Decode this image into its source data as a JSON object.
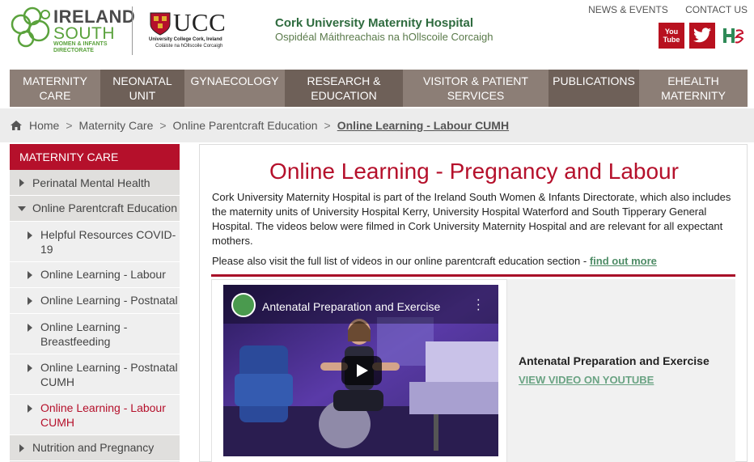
{
  "brand": {
    "is_logo_line1": "IRELAND",
    "is_logo_line2": "SOUTH",
    "is_logo_line3": "WOMEN & INFANTS DIRECTORATE",
    "ucc_logo": "UCC",
    "ucc_sub1": "University College Cork, Ireland",
    "ucc_sub2": "Coláiste na hOllscoile Corcaigh",
    "hospital_name": "Cork University Maternity Hospital",
    "hospital_irish": "Ospidéal Máithreachais na hOllscoile Corcaigh",
    "accent": "#b5102b",
    "nav_color": "#8c7e76",
    "nav_active_color": "#6e6058"
  },
  "toplinks": [
    "NEWS & EVENTS",
    "CONTACT US"
  ],
  "social": {
    "youtube_label_1": "You",
    "youtube_label_2": "Tube",
    "icons": [
      "youtube-icon",
      "twitter-icon",
      "hse-icon"
    ]
  },
  "nav": [
    {
      "label_1": "MATERNITY",
      "label_2": "CARE",
      "dark": false
    },
    {
      "label_1": "NEONATAL",
      "label_2": "UNIT",
      "dark": true
    },
    {
      "label_1": "GYNAECOLOGY",
      "label_2": "",
      "dark": false
    },
    {
      "label_1": "RESEARCH &",
      "label_2": "EDUCATION",
      "dark": true
    },
    {
      "label_1": "VISITOR & PATIENT",
      "label_2": "SERVICES",
      "dark": false
    },
    {
      "label_1": "PUBLICATIONS",
      "label_2": "",
      "dark": true
    },
    {
      "label_1": "EHEALTH",
      "label_2": "MATERNITY",
      "dark": false
    }
  ],
  "breadcrumb": {
    "home": "Home",
    "items": [
      "Maternity Care",
      "Online Parentcraft Education"
    ],
    "current": "Online Learning - Labour CUMH",
    "separator": ">"
  },
  "sidebar": {
    "heading": "MATERNITY CARE",
    "items": [
      {
        "label": "Perinatal Mental Health"
      },
      {
        "label": "Online Parentcraft Education"
      },
      {
        "label_1": "Helpful Resources COVID-",
        "label_2": "19"
      },
      {
        "label": "Online Learning - Labour"
      },
      {
        "label": "Online Learning - Postnatal"
      },
      {
        "label_1": "Online Learning -",
        "label_2": "Breastfeeding"
      },
      {
        "label_1": "Online Learning - Postnatal",
        "label_2": "CUMH"
      },
      {
        "label_1": "Online Learning - Labour",
        "label_2": "CUMH"
      },
      {
        "label": "Nutrition and Pregnancy"
      }
    ]
  },
  "main": {
    "title": "Online Learning - Pregnancy and Labour",
    "intro": "Cork University Maternity Hospital is part of the Ireland South Women & Infants Directorate, which also includes the maternity units of University Hospital Kerry, University Hospital Waterford and South Tipperary General Hospital.  The videos below were filmed in Cork University Maternity Hospital and are relevant for all expectant mothers.",
    "also_text": "Please also visit the full list of videos in our online parentcraft education section - ",
    "also_link": "find out more",
    "video": {
      "player_title": "Antenatal Preparation and Exercise",
      "title": "Antenatal Preparation and Exercise",
      "link": "VIEW VIDEO ON YOUTUBE"
    }
  }
}
